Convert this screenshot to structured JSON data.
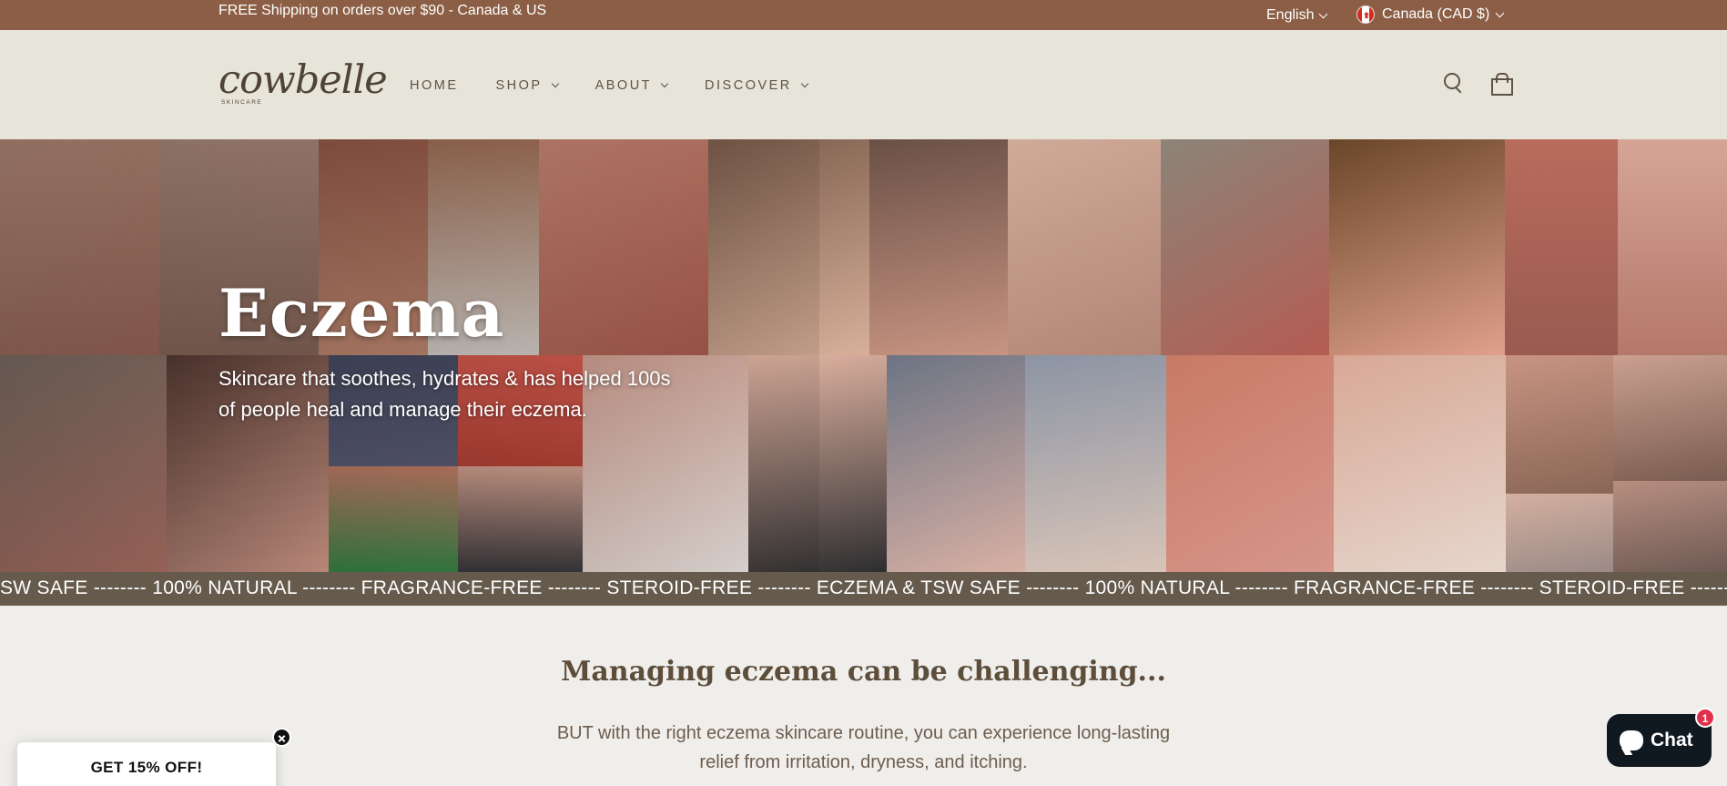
{
  "announcement": {
    "shipping_text": "FREE Shipping on orders over $90 - Canada & US",
    "language": "English",
    "currency": "Canada (CAD $)"
  },
  "header": {
    "logo_text": "cowbelle",
    "logo_sub": "SKINCARE",
    "nav": [
      {
        "label": "HOME",
        "has_dropdown": false
      },
      {
        "label": "SHOP",
        "has_dropdown": true
      },
      {
        "label": "ABOUT",
        "has_dropdown": true
      },
      {
        "label": "DISCOVER",
        "has_dropdown": true
      }
    ],
    "icons": [
      "search-icon",
      "cart-icon"
    ]
  },
  "hero": {
    "title": "Eczema",
    "subtitle": "Skincare that soothes, hydrates & has helped 100s of people heal and manage their eczema."
  },
  "marquee": {
    "text": "SW SAFE --------  100% NATURAL -------- FRAGRANCE-FREE -------- STEROID-FREE -------- ECZEMA & TSW SAFE --------  100% NATURAL -------- FRAGRANCE-FREE -------- STEROID-FREE -------- ECZEMA & TSW SAFE"
  },
  "content": {
    "heading": "Managing eczema can be challenging...",
    "body": "BUT with the right eczema skincare routine, you can experience long-lasting relief from irritation, dryness, and itching."
  },
  "popup": {
    "label": "GET 15% OFF!"
  },
  "chat": {
    "label": "Chat",
    "badge": "1"
  },
  "colors": {
    "announcement_bg": "#8b5e45",
    "header_bg": "#e7e4da",
    "marquee_bg": "#655a4c",
    "page_bg": "#f0eeea",
    "heading": "#5d4e3c",
    "chat_bg": "#101820",
    "badge": "#e1304c"
  }
}
